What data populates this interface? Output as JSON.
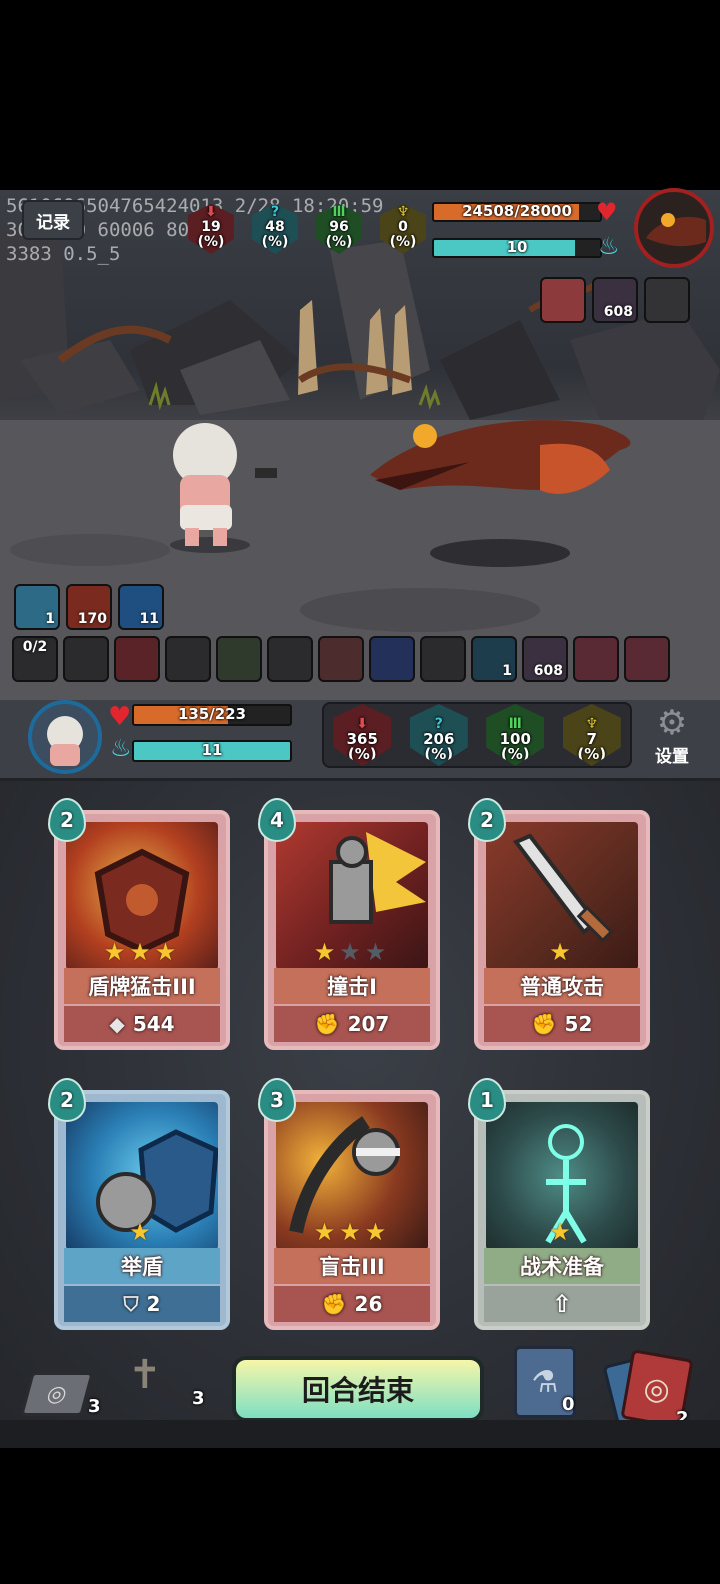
{
  "debug": {
    "line1": "5610696504765424013 2/28 18:20:59",
    "line2": "30006 0 60006 800",
    "line3": "3383 0.5_5"
  },
  "top_left_button": "记录",
  "enemy_stats": [
    {
      "icon": "red-arrow-icon",
      "value": "19",
      "unit": "(%)",
      "color": "#c03a3f"
    },
    {
      "icon": "question-icon",
      "value": "48",
      "unit": "(%)",
      "color": "#35b1c1"
    },
    {
      "icon": "green-bars-icon",
      "value": "96",
      "unit": "(%)",
      "color": "#3fb24a"
    },
    {
      "icon": "yellow-bird-icon",
      "value": "0",
      "unit": "(%)",
      "color": "#c8b42e"
    }
  ],
  "enemy": {
    "hp_text": "24508/28000",
    "hp_fraction": 0.875,
    "energy_text": "10",
    "energy_fraction": 0.85,
    "buffs": [
      {
        "icon": "demon-face-icon",
        "count": ""
      },
      {
        "icon": "voodoo-doll-icon",
        "count": "608"
      },
      {
        "icon": "beast-jaw-icon",
        "count": ""
      }
    ]
  },
  "player_buffs": [
    {
      "icon": "ghost-mask-icon",
      "count": "1",
      "color": "#3d8fb0"
    },
    {
      "icon": "flame-icon",
      "count": "170",
      "color": "#b1402a"
    },
    {
      "icon": "blue-shield-icon",
      "count": "11",
      "color": "#2b79b8"
    }
  ],
  "relics": [
    {
      "icon": "dagger-icon",
      "count": "0/2"
    },
    {
      "icon": "owl-icon",
      "count": ""
    },
    {
      "icon": "red-totem-icon",
      "count": ""
    },
    {
      "icon": "fist-icon",
      "count": ""
    },
    {
      "icon": "hourglass-icon",
      "count": ""
    },
    {
      "icon": "teddy-bear-icon",
      "count": ""
    },
    {
      "icon": "meat-icon",
      "count": ""
    },
    {
      "icon": "blue-rune-icon",
      "count": ""
    },
    {
      "icon": "binoculars-icon",
      "count": ""
    },
    {
      "icon": "shadow-orb-icon",
      "count": "1"
    },
    {
      "icon": "voodoo-doll-icon",
      "count": "608"
    },
    {
      "icon": "chain-link-icon",
      "count": ""
    },
    {
      "icon": "chain-link-icon",
      "count": ""
    }
  ],
  "player": {
    "hp_text": "135/223",
    "hp_fraction": 0.605,
    "energy_text": "11",
    "energy_fraction": 1.0
  },
  "player_stats": [
    {
      "icon": "red-arrow-icon",
      "value": "365",
      "unit": "(%)",
      "color": "#c03a3f"
    },
    {
      "icon": "question-icon",
      "value": "206",
      "unit": "(%)",
      "color": "#35b1c1"
    },
    {
      "icon": "green-bars-icon",
      "value": "100",
      "unit": "(%)",
      "color": "#3fb24a"
    },
    {
      "icon": "yellow-bird-icon",
      "value": "7",
      "unit": "(%)",
      "color": "#c8b42e"
    }
  ],
  "settings_label": "设置",
  "cards": [
    {
      "cost": "2",
      "title": "盾牌猛击III",
      "value": "544",
      "value_icon": "armor-plate-icon",
      "stars": 3,
      "max_stars": 3,
      "style": "red"
    },
    {
      "cost": "4",
      "title": "撞击I",
      "value": "207",
      "value_icon": "fist-strike-icon",
      "stars": 1,
      "max_stars": 3,
      "style": "red"
    },
    {
      "cost": "2",
      "title": "普通攻击",
      "value": "52",
      "value_icon": "fist-strike-icon",
      "stars": 1,
      "max_stars": 1,
      "style": "red"
    },
    {
      "cost": "2",
      "title": "举盾",
      "value": "2",
      "value_icon": "shield-outline-icon",
      "stars": 1,
      "max_stars": 1,
      "style": "blue"
    },
    {
      "cost": "3",
      "title": "盲击III",
      "value": "26",
      "value_icon": "fist-strike-icon",
      "stars": 3,
      "max_stars": 3,
      "style": "red"
    },
    {
      "cost": "1",
      "title": "战术准备",
      "value": "",
      "value_icon": "up-arrow-icon",
      "stars": 1,
      "max_stars": 1,
      "style": "grey"
    }
  ],
  "bottom": {
    "draw_pile_count": "3",
    "grave_count": "3",
    "end_turn_label": "回合结束",
    "potion_count": "0",
    "discard_count": "2"
  }
}
